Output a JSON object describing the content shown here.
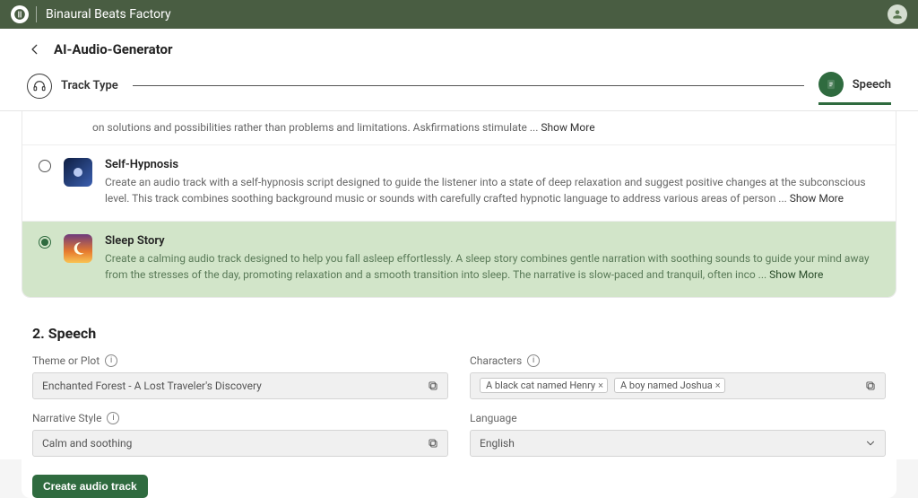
{
  "app": {
    "name": "Binaural Beats Factory"
  },
  "page": {
    "title": "AI-Audio-Generator"
  },
  "steps": {
    "track_type": "Track Type",
    "speech": "Speech"
  },
  "options": {
    "askf": {
      "desc_fragment": "on solutions and possibilities rather than problems and limitations. Askfirmations stimulate ... ",
      "showmore": "Show More"
    },
    "self_hypnosis": {
      "title": "Self-Hypnosis",
      "desc": "Create an audio track with a self-hypnosis script designed to guide the listener into a state of deep relaxation and suggest positive changes at the subconscious level. This track combines soothing background music or sounds with carefully crafted hypnotic language to address various areas of person ... ",
      "showmore": "Show More"
    },
    "sleep_story": {
      "title": "Sleep Story",
      "desc": "Create a calming audio track designed to help you fall asleep effortlessly. A sleep story combines gentle narration with soothing sounds to guide your mind away from the stresses of the day, promoting relaxation and a smooth transition into sleep. The narrative is slow-paced and tranquil, often inco ... ",
      "showmore": "Show More"
    }
  },
  "speech": {
    "section_title": "2. Speech",
    "theme_label": "Theme or Plot",
    "theme_value": "Enchanted Forest - A Lost Traveler's Discovery",
    "characters_label": "Characters",
    "characters": [
      "A black cat named Henry",
      "A boy named Joshua"
    ],
    "narrative_label": "Narrative Style",
    "narrative_value": "Calm and soothing",
    "language_label": "Language",
    "language_value": "English"
  },
  "cta": {
    "label": "Create audio track"
  }
}
